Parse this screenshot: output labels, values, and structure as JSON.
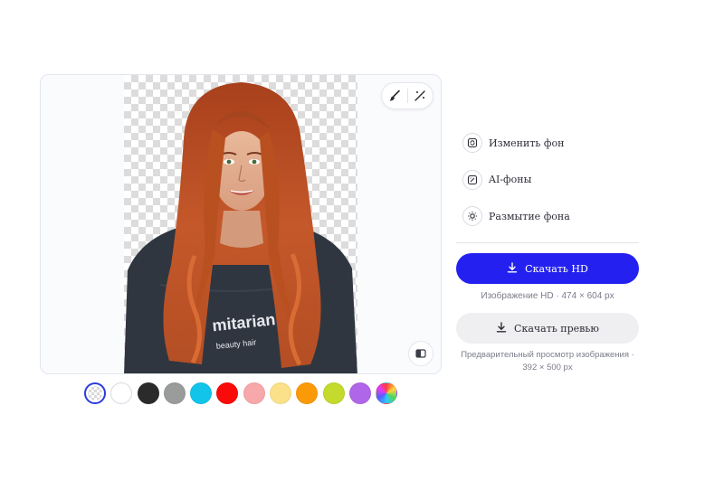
{
  "editor": {
    "tools": [
      {
        "icon": "brush-icon"
      },
      {
        "icon": "magic-wand-icon"
      }
    ],
    "compare_icon": "compare-icon"
  },
  "background_colors": [
    {
      "name": "transparent",
      "color": "transparent",
      "selected": true
    },
    {
      "name": "white",
      "color": "#ffffff"
    },
    {
      "name": "black",
      "color": "#2b2b2b"
    },
    {
      "name": "gray",
      "color": "#9a9c9c"
    },
    {
      "name": "cyan",
      "color": "#12c4ea"
    },
    {
      "name": "red",
      "color": "#fb0a0a"
    },
    {
      "name": "pink",
      "color": "#f7a8aa"
    },
    {
      "name": "light-yellow",
      "color": "#fbe28a"
    },
    {
      "name": "orange",
      "color": "#fb9a08"
    },
    {
      "name": "lime",
      "color": "#c4da2c"
    },
    {
      "name": "purple",
      "color": "#b066e8"
    },
    {
      "name": "custom",
      "color": "rainbow"
    }
  ],
  "options": [
    {
      "label": "Изменить фон",
      "icon": "change-background-icon"
    },
    {
      "label": "AI-фоны",
      "icon": "ai-backgrounds-icon"
    },
    {
      "label": "Размытие фона",
      "icon": "blur-icon"
    }
  ],
  "download_hd": {
    "label": "Скачать HD",
    "caption": "Изображение HD · 474 × 604 px",
    "color": "#2421f0"
  },
  "download_preview": {
    "label": "Скачать превью",
    "caption": "Предварительный просмотр изображения · 392 × 500 px"
  }
}
